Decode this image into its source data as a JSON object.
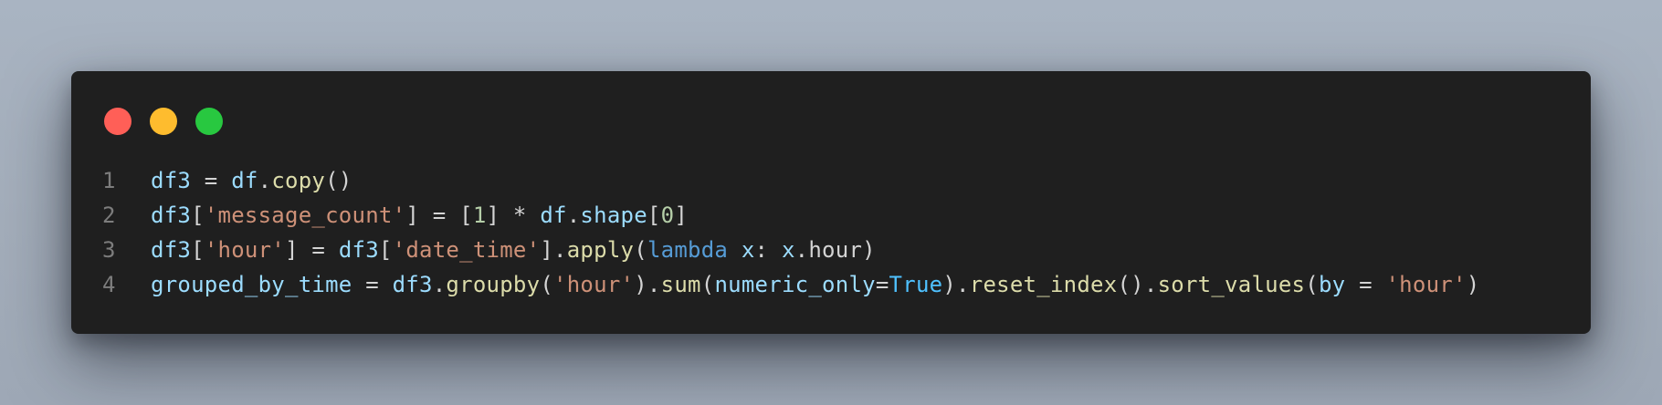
{
  "window": {
    "controls": [
      {
        "name": "close",
        "color": "#ff5f57"
      },
      {
        "name": "minimize",
        "color": "#febc2e"
      },
      {
        "name": "zoom",
        "color": "#28c840"
      }
    ]
  },
  "colors": {
    "background": "#a5afbc",
    "panel": "#1f1f1f",
    "line_number": "#7d7d7d",
    "plain": "#d4d4d4",
    "variable": "#9cdcfe",
    "function": "#dcdcaa",
    "string": "#ce9178",
    "number": "#b5cea8",
    "keyword": "#569cd6",
    "constant": "#4fc1ff",
    "bracket": "#d4d4d4"
  },
  "code": {
    "language": "python",
    "lines": [
      {
        "number": "1",
        "tokens": [
          {
            "text": "df3",
            "type": "variable"
          },
          {
            "text": " = ",
            "type": "plain"
          },
          {
            "text": "df",
            "type": "variable"
          },
          {
            "text": ".",
            "type": "plain"
          },
          {
            "text": "copy",
            "type": "function"
          },
          {
            "text": "()",
            "type": "plain"
          }
        ]
      },
      {
        "number": "2",
        "tokens": [
          {
            "text": "df3",
            "type": "variable"
          },
          {
            "text": "[",
            "type": "plain"
          },
          {
            "text": "'message_count'",
            "type": "string"
          },
          {
            "text": "] = [",
            "type": "plain"
          },
          {
            "text": "1",
            "type": "number"
          },
          {
            "text": "] * ",
            "type": "plain"
          },
          {
            "text": "df",
            "type": "variable"
          },
          {
            "text": ".",
            "type": "plain"
          },
          {
            "text": "shape",
            "type": "variable"
          },
          {
            "text": "[",
            "type": "plain"
          },
          {
            "text": "0",
            "type": "number"
          },
          {
            "text": "]",
            "type": "plain"
          }
        ]
      },
      {
        "number": "3",
        "tokens": [
          {
            "text": "df3",
            "type": "variable"
          },
          {
            "text": "[",
            "type": "plain"
          },
          {
            "text": "'hour'",
            "type": "string"
          },
          {
            "text": "] = ",
            "type": "plain"
          },
          {
            "text": "df3",
            "type": "variable"
          },
          {
            "text": "[",
            "type": "plain"
          },
          {
            "text": "'date_time'",
            "type": "string"
          },
          {
            "text": "].",
            "type": "plain"
          },
          {
            "text": "apply",
            "type": "function"
          },
          {
            "text": "(",
            "type": "plain"
          },
          {
            "text": "lambda",
            "type": "keyword"
          },
          {
            "text": " ",
            "type": "plain"
          },
          {
            "text": "x",
            "type": "variable"
          },
          {
            "text": ": ",
            "type": "plain"
          },
          {
            "text": "x",
            "type": "variable"
          },
          {
            "text": ".hour)",
            "type": "plain"
          }
        ]
      },
      {
        "number": "4",
        "tokens": [
          {
            "text": "grouped_by_time",
            "type": "variable"
          },
          {
            "text": " = ",
            "type": "plain"
          },
          {
            "text": "df3",
            "type": "variable"
          },
          {
            "text": ".",
            "type": "plain"
          },
          {
            "text": "groupby",
            "type": "function"
          },
          {
            "text": "(",
            "type": "plain"
          },
          {
            "text": "'hour'",
            "type": "string"
          },
          {
            "text": ").",
            "type": "plain"
          },
          {
            "text": "sum",
            "type": "function"
          },
          {
            "text": "(",
            "type": "plain"
          },
          {
            "text": "numeric_only",
            "type": "variable"
          },
          {
            "text": "=",
            "type": "plain"
          },
          {
            "text": "True",
            "type": "constant"
          },
          {
            "text": ").",
            "type": "plain"
          },
          {
            "text": "reset_index",
            "type": "function"
          },
          {
            "text": "().",
            "type": "plain"
          },
          {
            "text": "sort_values",
            "type": "function"
          },
          {
            "text": "(",
            "type": "plain"
          },
          {
            "text": "by",
            "type": "variable"
          },
          {
            "text": " = ",
            "type": "plain"
          },
          {
            "text": "'hour'",
            "type": "string"
          },
          {
            "text": ")",
            "type": "plain"
          }
        ]
      }
    ]
  }
}
